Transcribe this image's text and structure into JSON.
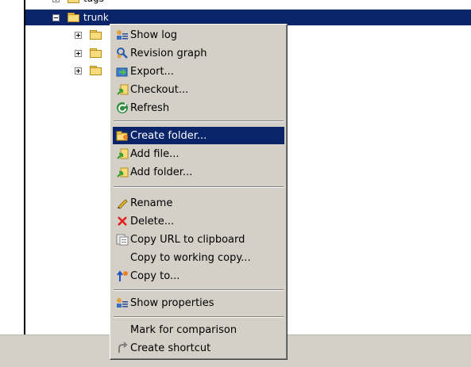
{
  "tree": {
    "partial_top_label": "tags",
    "selected_label": "trunk",
    "child_count": 3
  },
  "menu": {
    "items": [
      {
        "label": "Show log",
        "icon": "show-log-icon"
      },
      {
        "label": "Revision graph",
        "icon": "revision-graph-icon"
      },
      {
        "label": "Export...",
        "icon": "export-icon"
      },
      {
        "label": "Checkout...",
        "icon": "checkout-icon"
      },
      {
        "label": "Refresh",
        "icon": "refresh-icon"
      },
      {
        "label": "Create folder...",
        "icon": "create-folder-icon"
      },
      {
        "label": "Add file...",
        "icon": "add-file-icon"
      },
      {
        "label": "Add folder...",
        "icon": "add-folder-icon"
      },
      {
        "label": "Rename",
        "icon": "rename-icon"
      },
      {
        "label": "Delete...",
        "icon": "delete-icon"
      },
      {
        "label": "Copy URL to clipboard",
        "icon": "copy-url-icon"
      },
      {
        "label": "Copy to working copy...",
        "icon": ""
      },
      {
        "label": "Copy to...",
        "icon": "copy-to-icon"
      },
      {
        "label": "Show properties",
        "icon": "show-properties-icon"
      },
      {
        "label": "Mark for comparison",
        "icon": ""
      },
      {
        "label": "Create shortcut",
        "icon": "create-shortcut-icon"
      }
    ],
    "highlighted": "Create folder..."
  },
  "colors": {
    "selection": "#0a246a",
    "menu_bg": "#d4d0c8",
    "folder": "#f8db7d"
  }
}
